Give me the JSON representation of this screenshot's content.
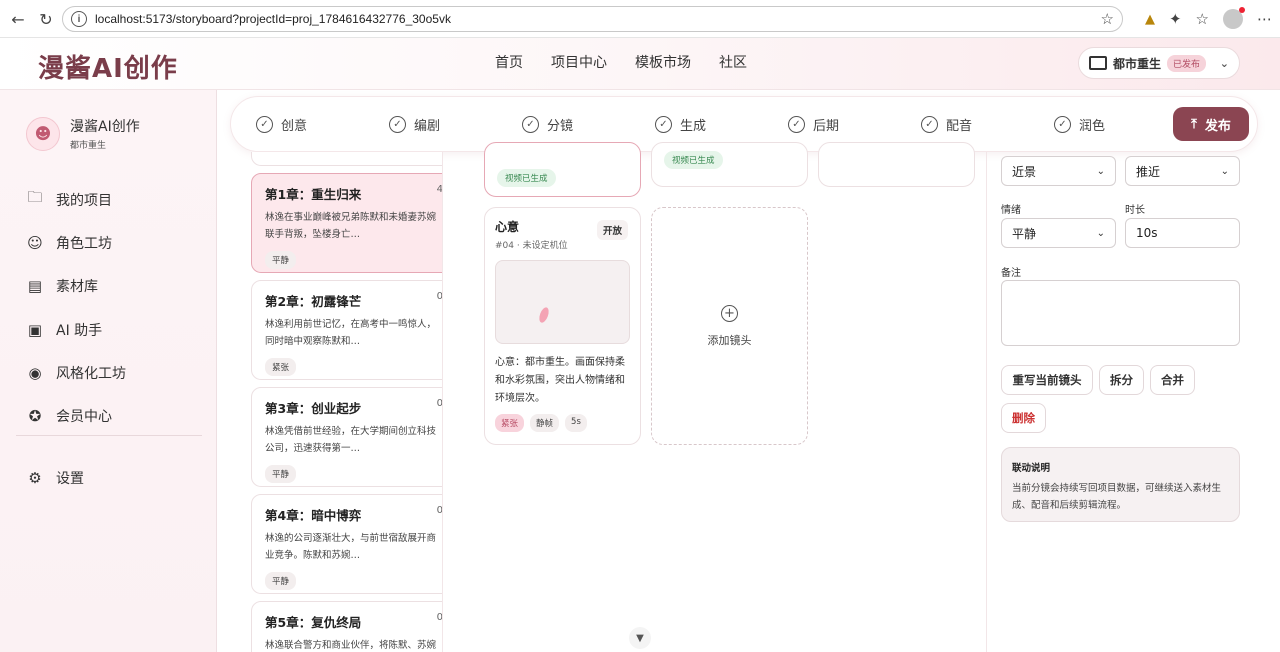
{
  "browser": {
    "url": "localhost:5173/storyboard?projectId=proj_1784616432776_30o5vk"
  },
  "header": {
    "brand": "漫酱AI创作",
    "nav": [
      "首页",
      "项目中心",
      "模板市场",
      "社区"
    ],
    "project_name": "都市重生",
    "project_status": "已发布"
  },
  "sidebar": {
    "brand": "漫酱AI创作",
    "sub": "都市重生",
    "items": [
      {
        "label": "我的项目",
        "icon": "folder-icon"
      },
      {
        "label": "角色工坊",
        "icon": "face-icon"
      },
      {
        "label": "素材库",
        "icon": "archive-icon"
      },
      {
        "label": "AI 助手",
        "icon": "robot-icon"
      },
      {
        "label": "风格化工坊",
        "icon": "palette-icon"
      },
      {
        "label": "会员中心",
        "icon": "star-icon"
      }
    ],
    "settings": "设置"
  },
  "stepper": {
    "steps": [
      "创意",
      "编剧",
      "分镜",
      "生成",
      "后期",
      "配音",
      "润色"
    ],
    "publish": "发布"
  },
  "chapters": [
    {
      "title": "第1章：重生归来",
      "count": "4",
      "desc": "林逸在事业巅峰被兄弟陈默和未婚妻苏婉联手背叛，坠楼身亡…",
      "tag": "平静",
      "active": true
    },
    {
      "title": "第2章：初露锋芒",
      "count": "0",
      "desc": "林逸利用前世记忆，在高考中一鸣惊人，同时暗中观察陈默和…",
      "tag": "紧张"
    },
    {
      "title": "第3章：创业起步",
      "count": "0",
      "desc": "林逸凭借前世经验，在大学期间创立科技公司，迅速获得第一…",
      "tag": "平静"
    },
    {
      "title": "第4章：暗中博弈",
      "count": "0",
      "desc": "林逸的公司逐渐壮大，与前世宿敌展开商业竞争。陈默和苏婉…",
      "tag": "平静"
    },
    {
      "title": "第5章：复仇终局",
      "count": "0",
      "desc": "林逸联合警方和商业伙伴，将陈默、苏婉",
      "tag": ""
    }
  ],
  "shots": {
    "stub_tag_1": "视频已生成",
    "stub_tag_2": "视频已生成",
    "card": {
      "title": "心意",
      "mode": "开放",
      "meta": "#04 · 未设定机位",
      "desc": "心意：都市重生。画面保持柔和水彩氛围，突出人物情绪和环境层次。",
      "tags": [
        "紧张",
        "静帧",
        "5s"
      ]
    },
    "add_label": "添加镜头"
  },
  "panel": {
    "shot_size": "近景",
    "camera_move": "推近",
    "emotion_label": "情绪",
    "emotion": "平静",
    "duration_label": "时长",
    "duration": "10s",
    "notes_label": "备注",
    "notes": "",
    "buttons": {
      "rewrite": "重写当前镜头",
      "split": "拆分",
      "merge": "合并",
      "delete": "删除"
    },
    "info_title": "联动说明",
    "info_body": "当前分镜会持续写回项目数据，可继续送入素材生成、配音和后续剪辑流程。"
  }
}
